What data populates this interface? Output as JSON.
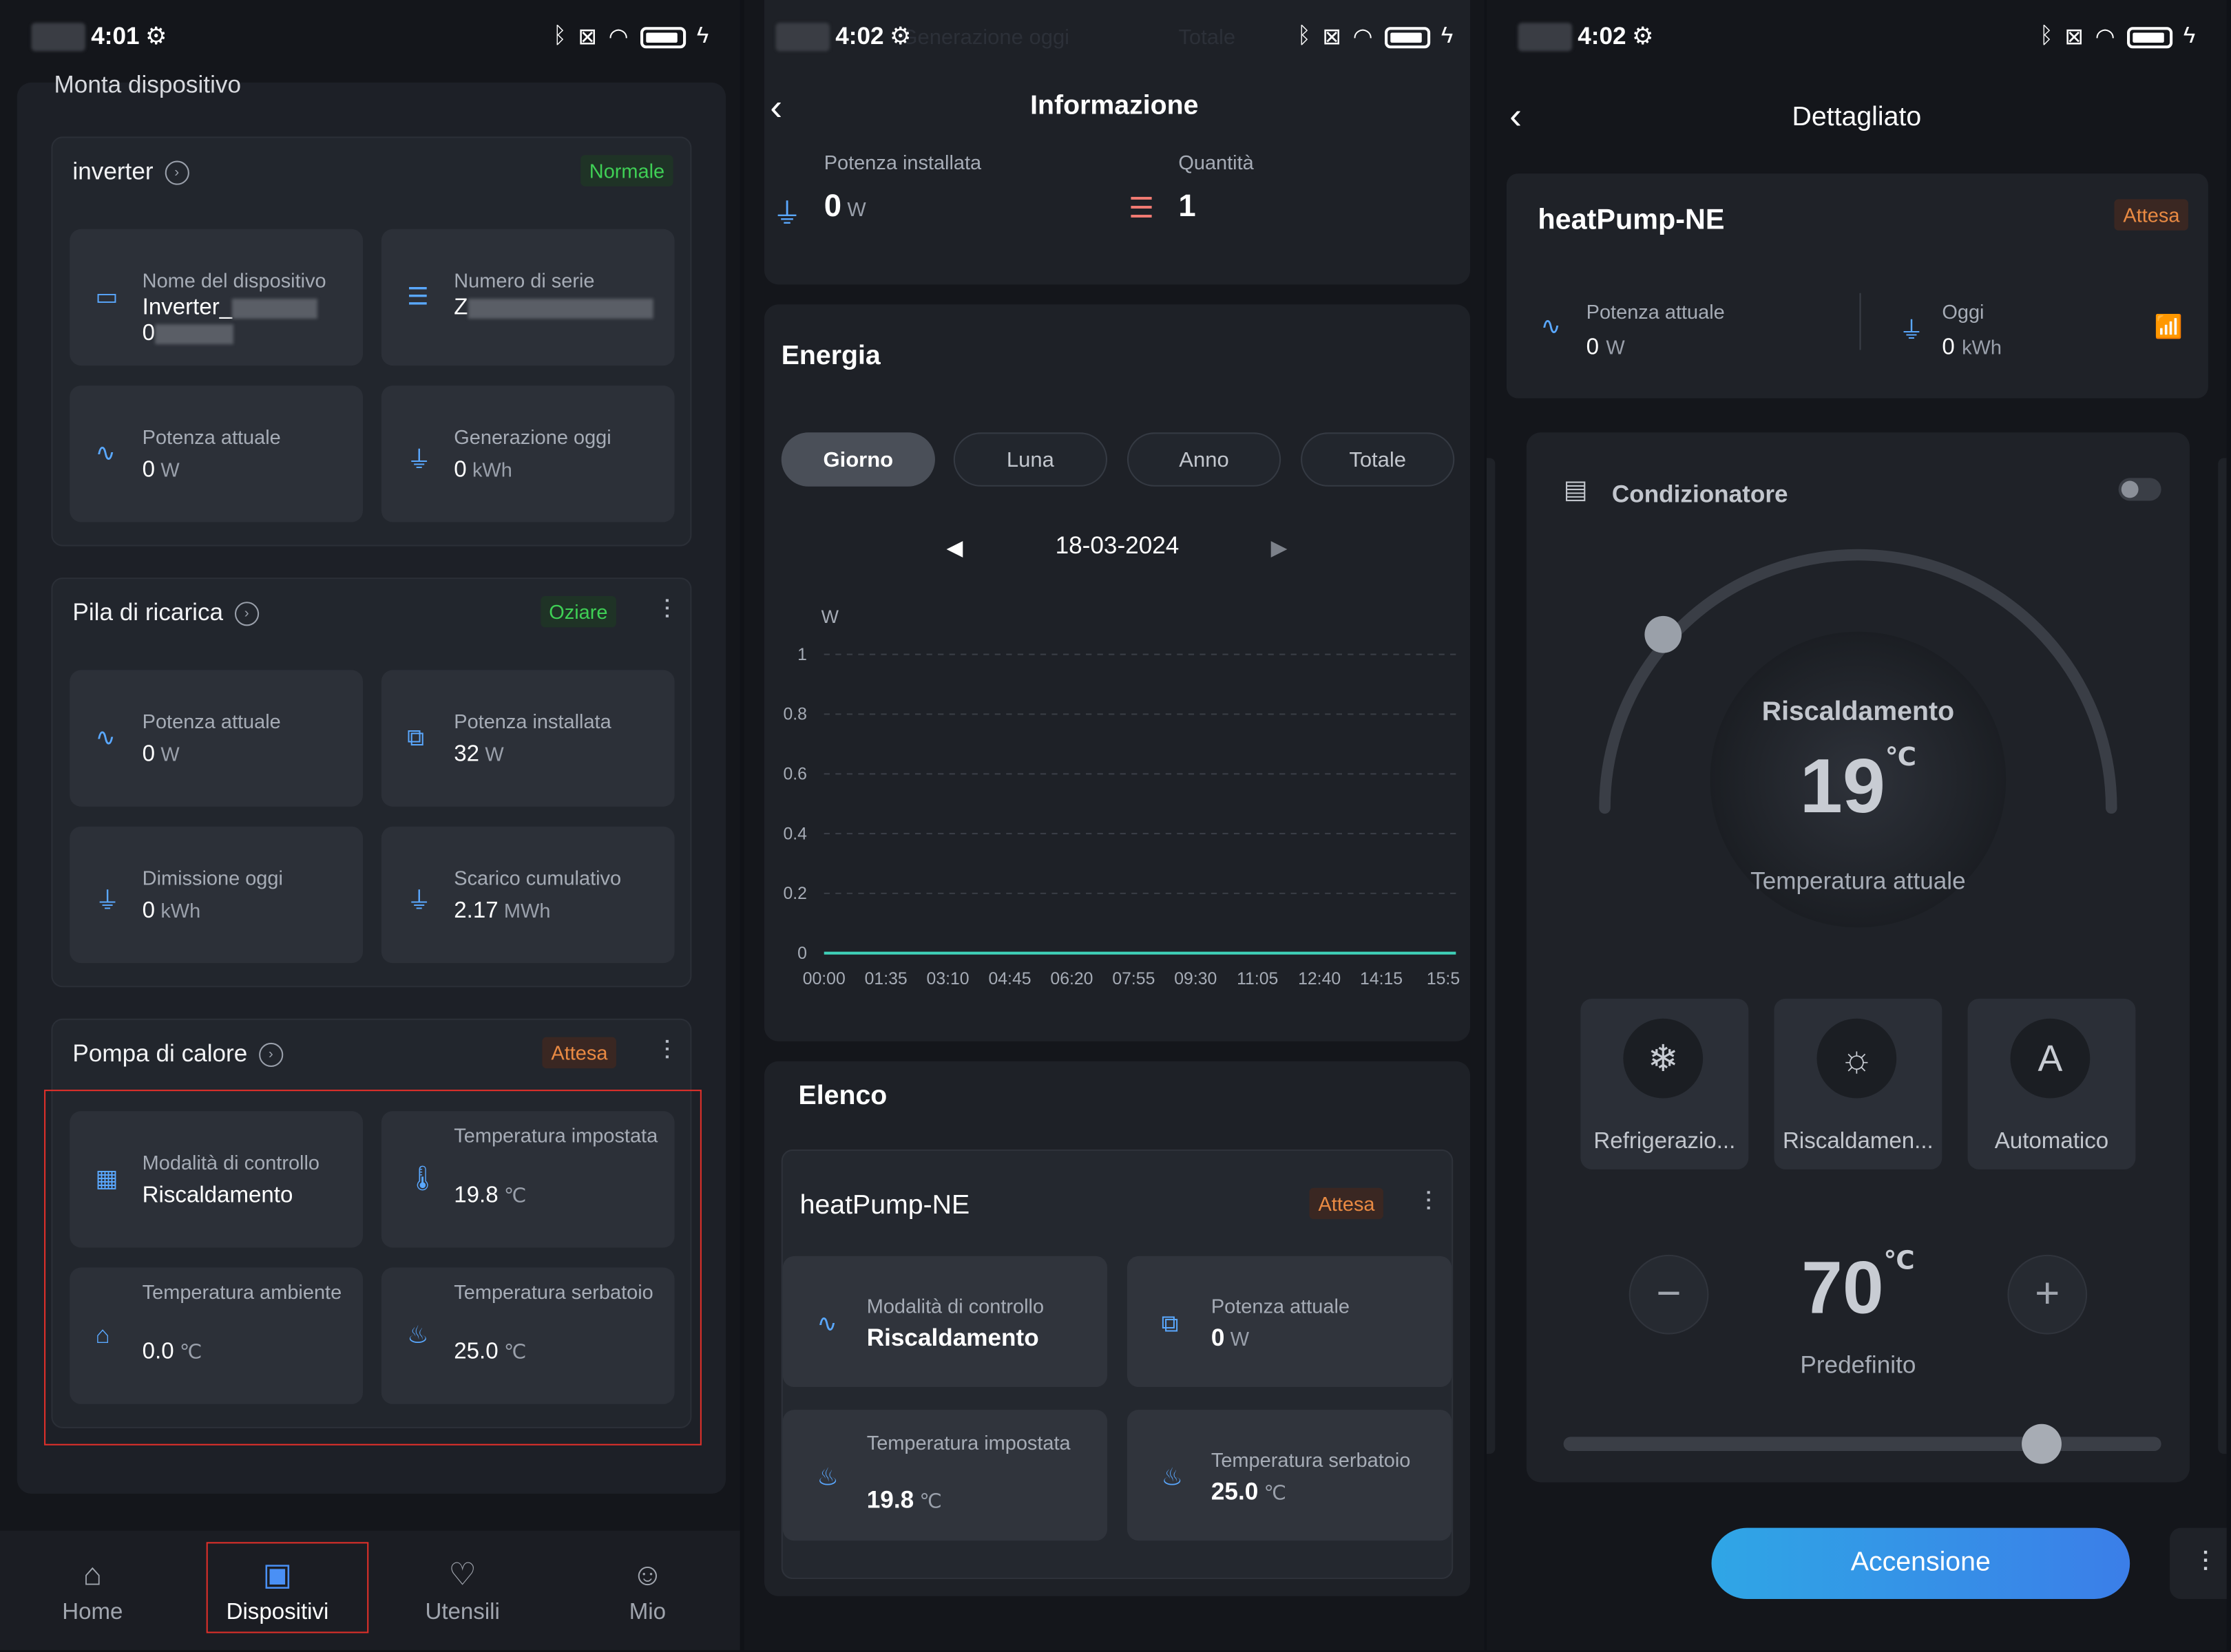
{
  "status": {
    "p1_time": "4:01",
    "p2_time": "4:02",
    "p3_time": "4:02"
  },
  "panel1": {
    "header": "Monta dispositivo",
    "inverter": {
      "title": "inverter",
      "badge": "Normale",
      "cards": [
        {
          "label": "Nome del dispositivo",
          "value": "Inverter_",
          "value2": "0"
        },
        {
          "label": "Numero di serie",
          "value": "Z"
        },
        {
          "label": "Potenza attuale",
          "value": "0",
          "unit": "W"
        },
        {
          "label": "Generazione oggi",
          "value": "0",
          "unit": "kWh"
        }
      ]
    },
    "charger": {
      "title": "Pila di ricarica",
      "badge": "Oziare",
      "cards": [
        {
          "label": "Potenza attuale",
          "value": "0",
          "unit": "W"
        },
        {
          "label": "Potenza installata",
          "value": "32",
          "unit": "W"
        },
        {
          "label": "Dimissione oggi",
          "value": "0",
          "unit": "kWh"
        },
        {
          "label": "Scarico cumulativo",
          "value": "2.17",
          "unit": "MWh"
        }
      ]
    },
    "heatpump": {
      "title": "Pompa di calore",
      "badge": "Attesa",
      "cards": [
        {
          "label": "Modalità di controllo",
          "value": "Riscaldamento"
        },
        {
          "label": "Temperatura impostata",
          "value": "19.8",
          "unit": "℃"
        },
        {
          "label": "Temperatura ambiente",
          "value": "0.0",
          "unit": "℃"
        },
        {
          "label": "Temperatura serbatoio",
          "value": "25.0",
          "unit": "℃"
        }
      ]
    },
    "nav": [
      "Home",
      "Dispositivi",
      "Utensili",
      "Mio"
    ]
  },
  "panel2": {
    "title": "Informazione",
    "ghost_left": "Generazione oggi",
    "ghost_right": "Totale",
    "installed_label": "Potenza installata",
    "installed_value": "0",
    "installed_unit": "W",
    "qty_label": "Quantità",
    "qty_value": "1",
    "energy_title": "Energia",
    "tabs": [
      "Giorno",
      "Luna",
      "Anno",
      "Totale"
    ],
    "date": "18-03-2024",
    "list_title": "Elenco",
    "device_name": "heatPump-NE",
    "device_badge": "Attesa",
    "cards": [
      {
        "label": "Modalità di controllo",
        "value": "Riscaldamento"
      },
      {
        "label": "Potenza attuale",
        "value": "0",
        "unit": "W"
      },
      {
        "label": "Temperatura impostata",
        "value": "19.8",
        "unit": "℃"
      },
      {
        "label": "Temperatura serbatoio",
        "value": "25.0",
        "unit": "℃"
      }
    ]
  },
  "chart_data": {
    "type": "line",
    "title": "",
    "xlabel": "",
    "ylabel": "W",
    "x": [
      "00:00",
      "01:35",
      "03:10",
      "04:45",
      "06:20",
      "07:55",
      "09:30",
      "11:05",
      "12:40",
      "14:15",
      "15:5"
    ],
    "series": [
      {
        "values": [
          0,
          0,
          0,
          0,
          0,
          0,
          0,
          0,
          0,
          0,
          0
        ]
      }
    ],
    "yticks": [
      "0",
      "0.2",
      "0.4",
      "0.6",
      "0.8",
      "1"
    ],
    "ylim": [
      0,
      1
    ],
    "grid": true,
    "line_color": "#3fd1b8"
  },
  "panel3": {
    "title": "Dettagliato",
    "device_name": "heatPump-NE",
    "badge": "Attesa",
    "power_label": "Potenza attuale",
    "power_value": "0",
    "power_unit": "W",
    "today_label": "Oggi",
    "today_value": "0",
    "today_unit": "kWh",
    "ac_label": "Condizionatore",
    "mode_label": "Riscaldamento",
    "current_temp": "19",
    "temp_unit": "℃",
    "current_temp_label": "Temperatura attuale",
    "modes": [
      "Refrigerazio...",
      "Riscaldamen...",
      "Automatico"
    ],
    "set_temp": "70",
    "set_temp_label": "Predefinito",
    "slider_level": 0.8,
    "power_button": "Accensione"
  },
  "colors": {
    "accent_blue": "#4a90f5",
    "badge_green": "#3fcf55",
    "badge_orange": "#e98a43",
    "highlight_red": "#e0302a"
  }
}
